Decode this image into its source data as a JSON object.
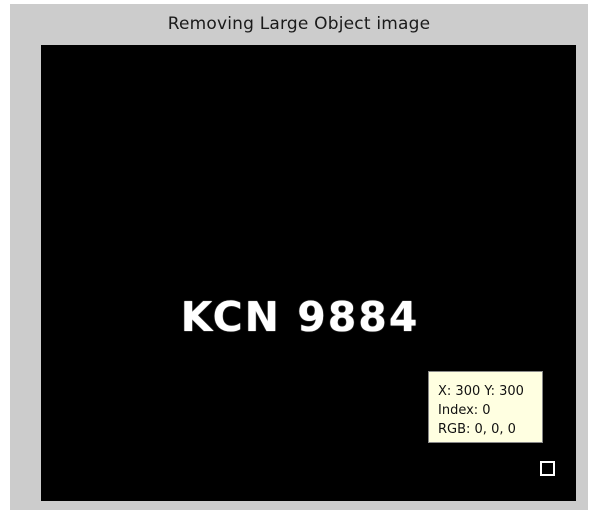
{
  "figure": {
    "title": "Removing Large Object image"
  },
  "image": {
    "plate_text": "KCN 9884",
    "background_color": "#000000",
    "text_color": "#ffffff"
  },
  "datatip": {
    "position_line": "X: 300 Y: 300",
    "index_line": "Index: 0",
    "rgb_line": "RGB: 0, 0, 0",
    "background_color": "#ffffe1"
  }
}
